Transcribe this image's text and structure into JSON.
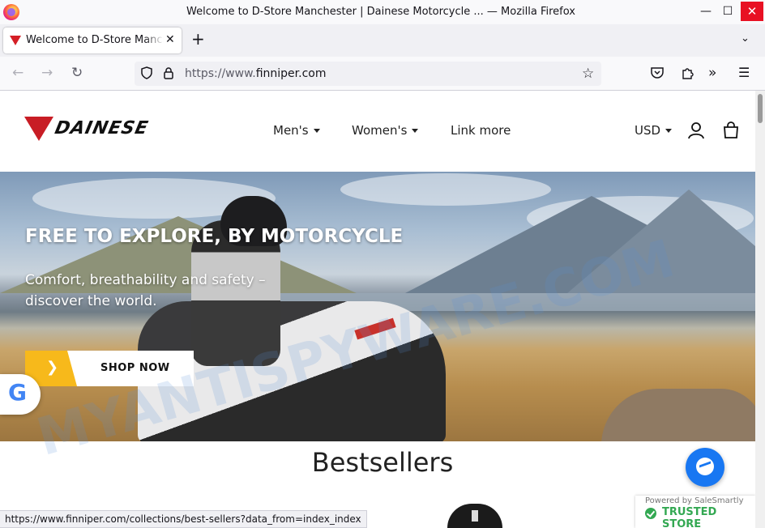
{
  "window": {
    "title": "Welcome to D-Store Manchester | Dainese Motorcycle ... — Mozilla Firefox",
    "minimize_icon": "minimize-icon",
    "maximize_icon": "maximize-icon",
    "close_icon": "close-icon"
  },
  "tabs": [
    {
      "label": "Welcome to D-Store Manchester | Dainese Motorcycle",
      "active": true
    }
  ],
  "navbar": {
    "url_prefix": "https://www.",
    "url_domain": "finniper.com"
  },
  "site": {
    "logo_text": "DAINESE",
    "menu": [
      "Men's",
      "Women's",
      "Link more"
    ],
    "currency": "USD",
    "brand_color": "#c81d25"
  },
  "hero": {
    "title": "FREE TO EXPLORE, BY MOTORCYCLE",
    "subtitle": "Comfort, breathability and safety – discover the world.",
    "cta": "SHOP NOW",
    "cta_accent": "#f7b91b"
  },
  "watermark": "MYANTISPYWARE.COM",
  "section_title": "Bestsellers",
  "trust_badge": {
    "powered": "Powered by SaleSmartly",
    "label": "TRUSTED STORE",
    "color": "#33a852"
  },
  "status_url": "https://www.finniper.com/collections/best-sellers?data_from=index_index",
  "messenger_color": "#1877f2"
}
